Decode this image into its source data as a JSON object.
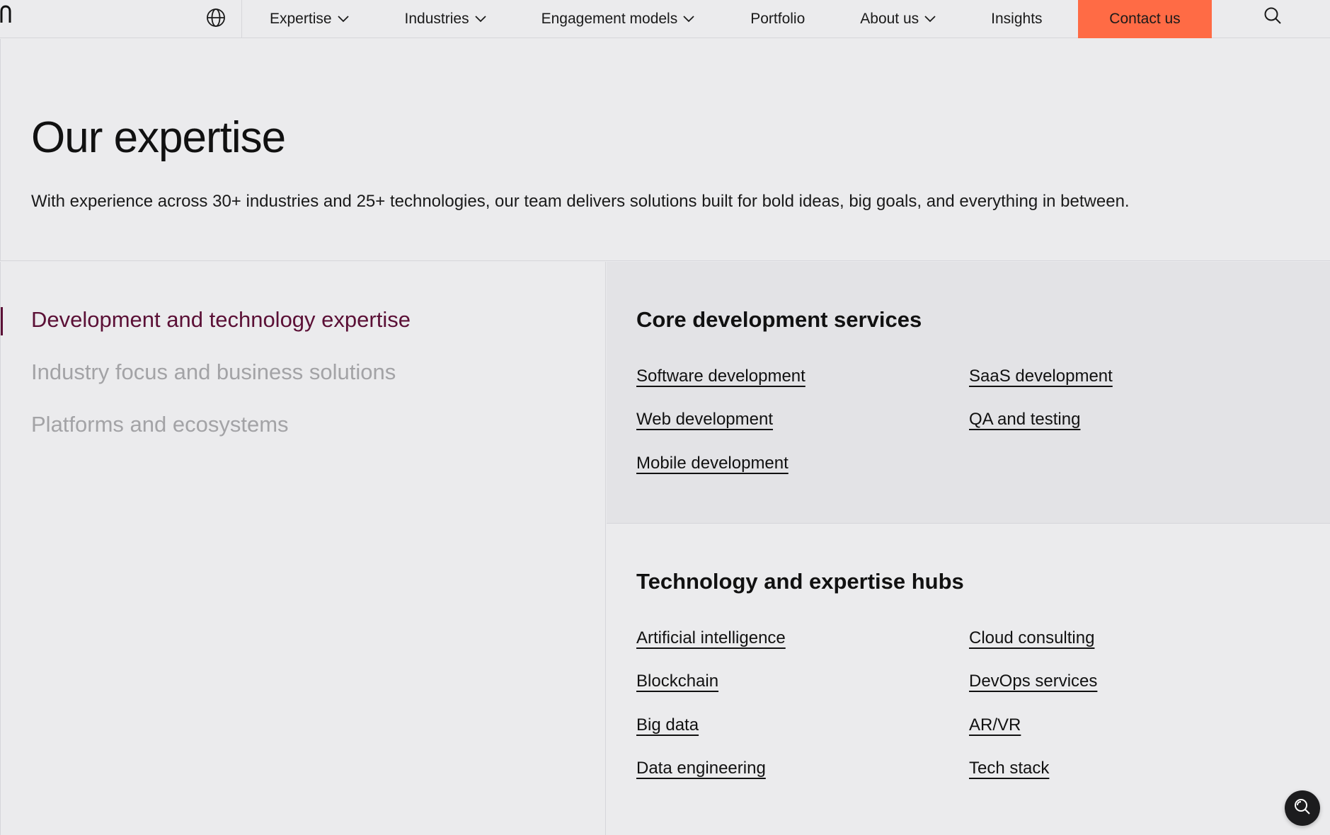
{
  "nav": {
    "items": [
      {
        "label": "Expertise",
        "has_dropdown": true
      },
      {
        "label": "Industries",
        "has_dropdown": true
      },
      {
        "label": "Engagement models",
        "has_dropdown": true
      },
      {
        "label": "Portfolio",
        "has_dropdown": false
      },
      {
        "label": "About us",
        "has_dropdown": true
      },
      {
        "label": "Insights",
        "has_dropdown": false
      }
    ],
    "contact_label": "Contact us",
    "globe_icon": "globe-icon",
    "search_icon": "search-icon"
  },
  "hero": {
    "title": "Our expertise",
    "subtitle": "With experience across 30+ industries and 25+ technologies, our team delivers solutions built for bold ideas, big goals, and everything in between."
  },
  "categories": [
    {
      "label": "Development and technology expertise",
      "active": true
    },
    {
      "label": "Industry focus and business solutions",
      "active": false
    },
    {
      "label": "Platforms and ecosystems",
      "active": false
    }
  ],
  "sections": {
    "core": {
      "title": "Core development services",
      "links": [
        "Software development",
        "SaaS development",
        "Web development",
        "QA and testing",
        "Mobile development"
      ]
    },
    "hubs": {
      "title": "Technology and expertise hubs",
      "links": [
        "Artificial intelligence",
        "Cloud consulting",
        "Blockchain",
        "DevOps services",
        "Big data",
        "AR/VR",
        "Data engineering",
        "Tech stack"
      ]
    }
  },
  "colors": {
    "background": "#ebebed",
    "panel": "#e3e3e6",
    "accent": "#ff6b45",
    "active_category": "#5b1036",
    "inactive_category": "#a3a3a6"
  }
}
